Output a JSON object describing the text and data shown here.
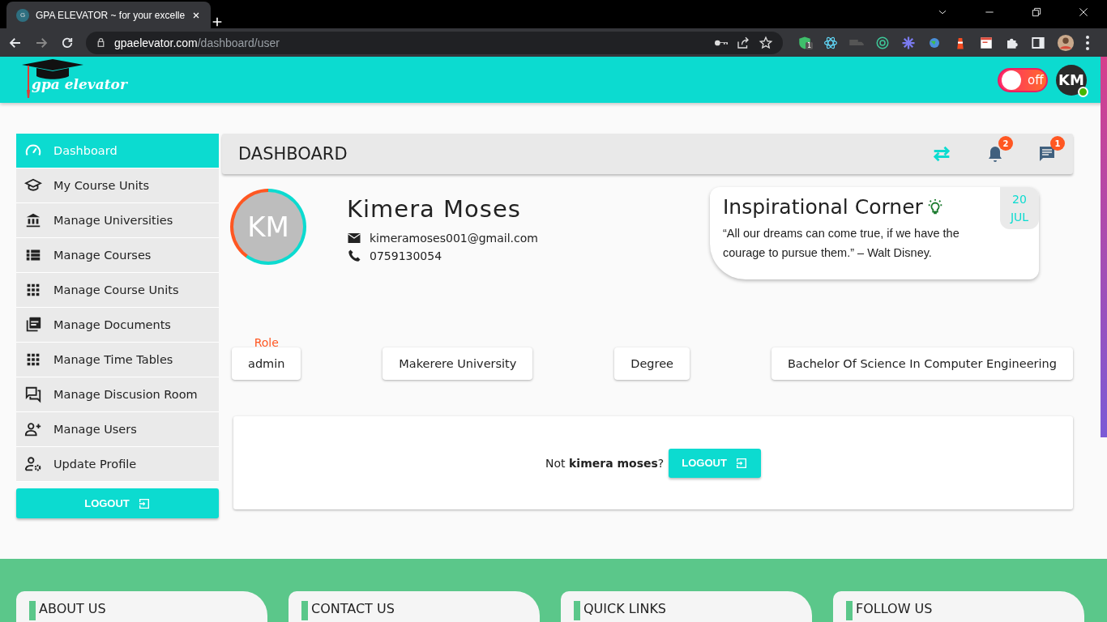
{
  "browser": {
    "tab_title": "GPA ELEVATOR ~ for your excelle",
    "tab_favicon": "G",
    "url_host": "gpaelevator.com",
    "url_path": "/dashboard/user",
    "extension_badge": "1"
  },
  "header": {
    "logo_text": "gpa elevator",
    "theme_toggle": {
      "label": "off",
      "on": false
    },
    "avatar": {
      "initials": "KM",
      "online": true
    }
  },
  "sidebar": {
    "items": [
      {
        "label": "Dashboard",
        "selected": true
      },
      {
        "label": "My Course Units",
        "selected": false
      },
      {
        "label": "Manage Universities",
        "selected": false
      },
      {
        "label": "Manage Courses",
        "selected": false
      },
      {
        "label": "Manage Course Units",
        "selected": false
      },
      {
        "label": "Manage Documents",
        "selected": false
      },
      {
        "label": "Manage Time Tables",
        "selected": false
      },
      {
        "label": "Manage Discusion Room",
        "selected": false
      },
      {
        "label": "Manage Users",
        "selected": false
      },
      {
        "label": "Update Profile",
        "selected": false
      }
    ],
    "logout_button": "LOGOUT"
  },
  "panel": {
    "title": "DASHBOARD",
    "notification_count": "2",
    "message_count": "1"
  },
  "profile": {
    "initials": "KM",
    "name": "Kimera Moses",
    "email": "kimeramoses001@gmail.com",
    "phone": "0759130054"
  },
  "inspiration": {
    "title": "Inspirational Corner",
    "quote": "“All our dreams can come true, if we have the courage to pursue them.” – Walt Disney.",
    "day": "20",
    "month": "JUL"
  },
  "info_chips": [
    {
      "label": "Role",
      "value": "admin"
    },
    {
      "value": "Makerere University"
    },
    {
      "value": "Degree"
    },
    {
      "value": "Bachelor Of Science In Computer Engineering"
    }
  ],
  "logout_card": {
    "text": "Not **kimera moses**?",
    "button": "LOGOUT"
  },
  "footer": {
    "sections": [
      "ABOUT US",
      "CONTACT US",
      "QUICK LINKS",
      "FOLLOW US"
    ]
  }
}
